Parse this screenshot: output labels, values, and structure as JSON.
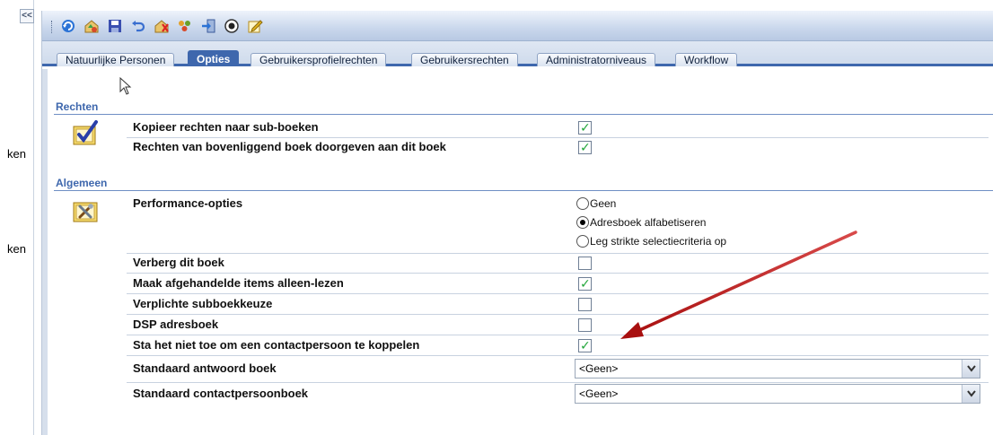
{
  "left_strip": {
    "collapse_glyph": "<<",
    "labels": [
      "ken",
      "ken"
    ]
  },
  "toolbar": {
    "buttons": [
      {
        "name": "refresh-icon",
        "color": "#2b73d6"
      },
      {
        "name": "home-recycle-icon",
        "color": "#3aa14a"
      },
      {
        "name": "save-icon",
        "color": "#3a4fb0"
      },
      {
        "name": "undo-icon",
        "color": "#3a6fd0"
      },
      {
        "name": "delete-icon",
        "color": "#d8a020"
      },
      {
        "name": "recycle-icon",
        "color": "#6aa02a"
      },
      {
        "name": "export-icon",
        "color": "#2b73d6"
      },
      {
        "name": "preview-icon",
        "color": "#222222"
      },
      {
        "name": "edit-icon",
        "color": "#e2b31c"
      }
    ]
  },
  "tabs": [
    {
      "label": "Natuurlijke Personen",
      "active": false
    },
    {
      "label": "Opties",
      "active": true
    },
    {
      "label": "Gebruikersprofielrechten",
      "active": false
    },
    {
      "label": "Gebruikersrechten",
      "active": false
    },
    {
      "label": "Administratorniveaus",
      "active": false
    },
    {
      "label": "Workflow",
      "active": false
    }
  ],
  "sections": {
    "rechten": {
      "title": "Rechten",
      "rows": [
        {
          "label": "Kopieer rechten naar sub-boeken",
          "checked": true
        },
        {
          "label": "Rechten van bovenliggend boek doorgeven aan dit boek",
          "checked": true
        }
      ]
    },
    "algemeen": {
      "title": "Algemeen",
      "performance": {
        "label": "Performance-opties",
        "options": [
          {
            "label": "Geen",
            "selected": false
          },
          {
            "label": "Adresboek alfabetiseren",
            "selected": true
          },
          {
            "label": "Leg strikte selectiecriteria op",
            "selected": false
          }
        ]
      },
      "rows": [
        {
          "label": "Verberg dit boek",
          "checked": false
        },
        {
          "label": "Maak afgehandelde items alleen-lezen",
          "checked": true
        },
        {
          "label": "Verplichte subboekkeuze",
          "checked": false
        },
        {
          "label": "DSP adresboek",
          "checked": false
        },
        {
          "label": "Sta het niet toe om een contactpersoon te koppelen",
          "checked": true
        }
      ],
      "selects": [
        {
          "label": "Standaard antwoord boek",
          "value": "<Geen>"
        },
        {
          "label": "Standaard contactpersoonboek",
          "value": "<Geen>"
        }
      ]
    }
  },
  "colors": {
    "accent": "#3e67ad",
    "check_tick": "#22a63a",
    "annotation_arrow": "#b01818"
  }
}
